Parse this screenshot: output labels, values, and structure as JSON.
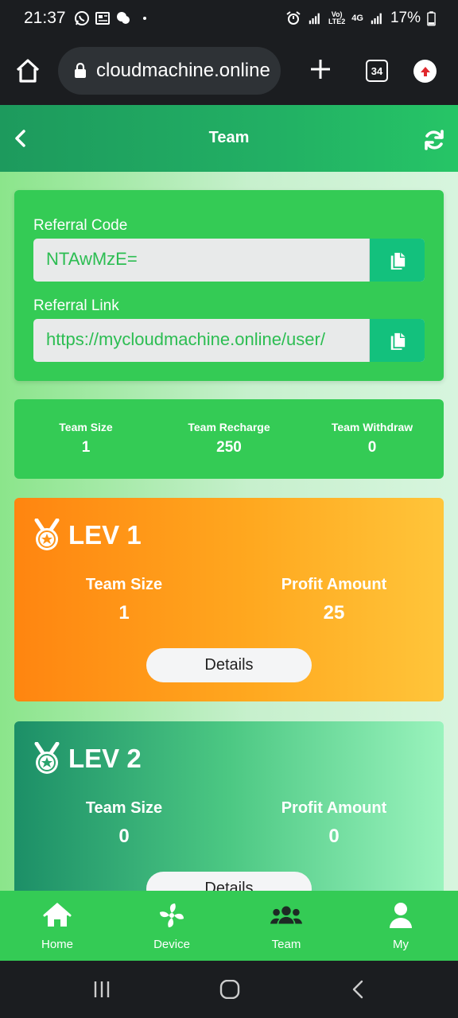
{
  "status_bar": {
    "time": "21:37",
    "network_top": "Vo)",
    "network_bottom": "LTE2",
    "network_gen": "4G",
    "battery": "17%"
  },
  "browser": {
    "url": "cloudmachine.online",
    "tab_count": "34"
  },
  "header": {
    "title": "Team"
  },
  "referral": {
    "code_label": "Referral Code",
    "code_value": "NTAwMzE=",
    "link_label": "Referral Link",
    "link_value": "https://mycloudmachine.online/user/"
  },
  "team_stats": [
    {
      "label": "Team Size",
      "value": "1"
    },
    {
      "label": "Team Recharge",
      "value": "250"
    },
    {
      "label": "Team Withdraw",
      "value": "0"
    }
  ],
  "levels": [
    {
      "title": "LEV 1",
      "size_label": "Team Size",
      "size_value": "1",
      "profit_label": "Profit Amount",
      "profit_value": "25",
      "button": "Details"
    },
    {
      "title": "LEV 2",
      "size_label": "Team Size",
      "size_value": "0",
      "profit_label": "Profit Amount",
      "profit_value": "0",
      "button": "Details"
    }
  ],
  "bottom_nav": [
    {
      "label": "Home",
      "icon": "home-icon"
    },
    {
      "label": "Device",
      "icon": "fan-icon"
    },
    {
      "label": "Team",
      "icon": "users-icon"
    },
    {
      "label": "My",
      "icon": "user-icon"
    }
  ],
  "colors": {
    "primary_green": "#34cb55",
    "copy_button": "#13c17d",
    "lev1_gradient": "#ff8510",
    "lev2_gradient": "#1c8f67"
  }
}
